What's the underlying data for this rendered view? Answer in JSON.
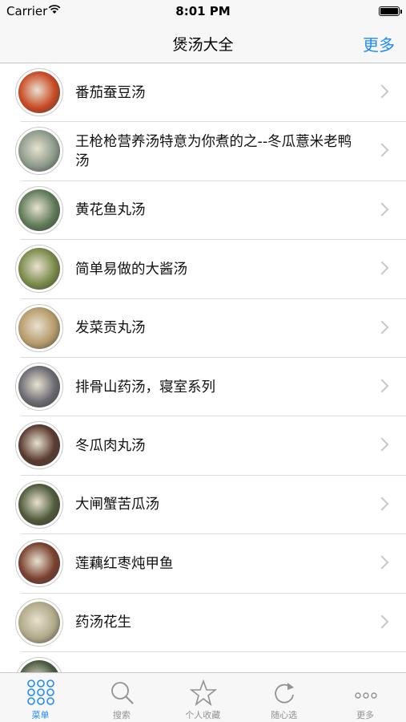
{
  "status": {
    "carrier": "Carrier",
    "time": "8:01 PM",
    "battery_level": 1.0
  },
  "nav": {
    "title": "煲汤大全",
    "more_label": "更多"
  },
  "colors": {
    "accent": "#1f8bf0",
    "tab_inactive": "#929292",
    "chevron": "#c7c7cc"
  },
  "recipes": [
    {
      "title": "番茄蚕豆汤",
      "thumb_color": "#c94a24"
    },
    {
      "title": "王枪枪营养汤特意为你煮的之--冬瓜薏米老鸭汤",
      "thumb_color": "#8c9a8a"
    },
    {
      "title": "黄花鱼丸汤",
      "thumb_color": "#5e7a58"
    },
    {
      "title": "简单易做的大酱汤",
      "thumb_color": "#7a8a4a"
    },
    {
      "title": "发菜贡丸汤",
      "thumb_color": "#b69a6a"
    },
    {
      "title": "排骨山药汤，寝室系列",
      "thumb_color": "#6c6a72"
    },
    {
      "title": "冬瓜肉丸汤",
      "thumb_color": "#5a3a30"
    },
    {
      "title": "大闸蟹苦瓜汤",
      "thumb_color": "#4f5a3a"
    },
    {
      "title": "莲藕红枣炖甲鱼",
      "thumb_color": "#7a4030"
    },
    {
      "title": "药汤花生",
      "thumb_color": "#b0a888"
    },
    {
      "title": "",
      "thumb_color": "#4a5a40"
    }
  ],
  "tabs": [
    {
      "label": "菜单",
      "icon": "grid-icon",
      "active": true
    },
    {
      "label": "搜索",
      "icon": "search-icon",
      "active": false
    },
    {
      "label": "个人收藏",
      "icon": "star-icon",
      "active": false
    },
    {
      "label": "随心选",
      "icon": "refresh-icon",
      "active": false
    },
    {
      "label": "更多",
      "icon": "more-icon",
      "active": false
    }
  ]
}
